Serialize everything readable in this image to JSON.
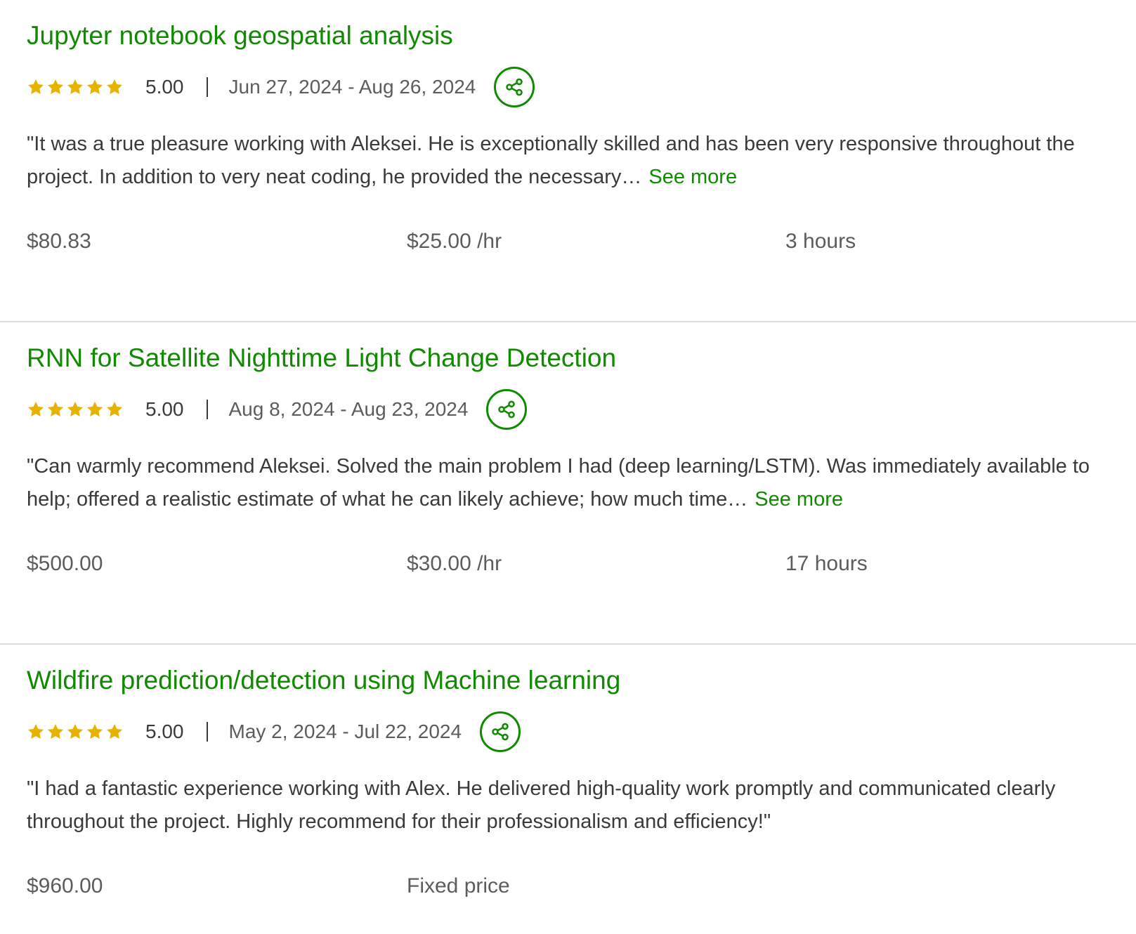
{
  "colors": {
    "accent": "#108a00",
    "star": "#e8b300",
    "divider": "#dcdcdc"
  },
  "icons": {
    "star": "star-icon",
    "share": "share-icon"
  },
  "see_more_label": "See more",
  "jobs": [
    {
      "title": "Jupyter notebook geospatial analysis",
      "rating_stars": 5,
      "rating": "5.00",
      "dates": "Jun 27, 2024 - Aug 26, 2024",
      "feedback": "\"It was a true pleasure working with Aleksei. He is exceptionally skilled and has been very responsive throughout the project. In addition to very neat coding, he provided the necessary…",
      "earned": "$80.83",
      "rate": "$25.00 /hr",
      "hours": "3 hours"
    },
    {
      "title": "RNN for Satellite Nighttime Light Change Detection",
      "rating_stars": 5,
      "rating": "5.00",
      "dates": "Aug 8, 2024 - Aug 23, 2024",
      "feedback": "\"Can warmly recommend Aleksei. Solved the main problem I had (deep learning/LSTM). Was immediately available to help; offered a realistic estimate of what he can likely achieve; how much time…",
      "earned": "$500.00",
      "rate": "$30.00 /hr",
      "hours": "17 hours"
    },
    {
      "title": "Wildfire prediction/detection using Machine learning",
      "rating_stars": 5,
      "rating": "5.00",
      "dates": "May 2, 2024 - Jul 22, 2024",
      "feedback": "\"I had a fantastic experience working with Alex. He delivered high-quality work promptly and communicated clearly throughout the project. Highly recommend for their professionalism and efficiency!\"",
      "earned": "$960.00",
      "rate": "Fixed price"
    }
  ]
}
